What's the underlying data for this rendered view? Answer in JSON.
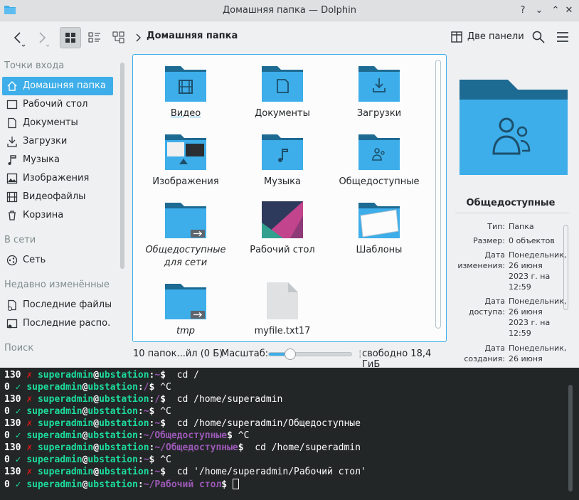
{
  "window": {
    "title": "Домашняя папка — Dolphin",
    "buttons": [
      "?",
      "⌄",
      "⌃",
      "✕"
    ]
  },
  "toolbar": {
    "breadcrumb": "Домашняя папка",
    "two_panels_label": "Две панели"
  },
  "sidebar": {
    "sections": {
      "places": "Точки входа",
      "network": "В сети",
      "recent": "Недавно изменённые",
      "search": "Поиск"
    },
    "places": [
      {
        "label": "Домашняя папка",
        "icon": "home-icon",
        "selected": true
      },
      {
        "label": "Рабочий стол",
        "icon": "desktop-icon"
      },
      {
        "label": "Документы",
        "icon": "documents-icon"
      },
      {
        "label": "Загрузки",
        "icon": "downloads-icon"
      },
      {
        "label": "Музыка",
        "icon": "music-icon"
      },
      {
        "label": "Изображения",
        "icon": "pictures-icon"
      },
      {
        "label": "Видеофайлы",
        "icon": "videos-icon"
      },
      {
        "label": "Корзина",
        "icon": "trash-icon"
      }
    ],
    "network": [
      {
        "label": "Сеть",
        "icon": "network-icon"
      }
    ],
    "recent": [
      {
        "label": "Последние файлы",
        "icon": "recent-files-icon"
      },
      {
        "label": "Последние распо...",
        "icon": "recent-locations-icon"
      }
    ]
  },
  "files": [
    {
      "name": "Видео",
      "kind": "videos-folder"
    },
    {
      "name": "Документы",
      "kind": "documents-folder"
    },
    {
      "name": "Загрузки",
      "kind": "downloads-folder"
    },
    {
      "name": "Изображения",
      "kind": "pictures-folder"
    },
    {
      "name": "Музыка",
      "kind": "music-folder"
    },
    {
      "name": "Общедоступные",
      "kind": "public-folder"
    },
    {
      "name": "Общедоступные для сети",
      "kind": "link-folder",
      "italic": true
    },
    {
      "name": "Рабочий стол",
      "kind": "desktop-thumbnail"
    },
    {
      "name": "Шаблоны",
      "kind": "templates-folder"
    },
    {
      "name": "tmp",
      "kind": "link-folder",
      "italic": true
    },
    {
      "name": "myfile.txt17",
      "kind": "text-file"
    }
  ],
  "status": {
    "summary": "10 папок...йл (0 Б)",
    "zoom_label": "Масштаб:",
    "zoom_value": 0.25,
    "free_space": "свободно 18,4 ГиБ"
  },
  "info_panel": {
    "name": "Общедоступные",
    "meta": [
      {
        "key": "Тип:",
        "value": "Папка"
      },
      {
        "key": "Размер:",
        "value": "0 объектов"
      },
      {
        "key": "Дата изменения:",
        "value": "Понедельник, 26 июня 2023 г. на 12:59"
      },
      {
        "key": "Дата доступа:",
        "value": "Понедельник, 26 июня 2023 г. на 12:59"
      },
      {
        "key": "Дата создания:",
        "value": "Понедельник, 26 июня"
      }
    ]
  },
  "terminal": {
    "lines": [
      {
        "code": "130",
        "ok": false,
        "user": "superadmin",
        "host": "ubstation",
        "path": "~",
        "cmd": " cd /"
      },
      {
        "code": "0",
        "ok": true,
        "user": "superadmin",
        "host": "ubstation",
        "path": "/",
        "cmd": "^C"
      },
      {
        "code": "130",
        "ok": false,
        "user": "superadmin",
        "host": "ubstation",
        "path": "/",
        "cmd": " cd /home/superadmin"
      },
      {
        "code": "0",
        "ok": true,
        "user": "superadmin",
        "host": "ubstation",
        "path": "~",
        "cmd": "^C"
      },
      {
        "code": "130",
        "ok": false,
        "user": "superadmin",
        "host": "ubstation",
        "path": "~",
        "cmd": " cd /home/superadmin/Общедоступные"
      },
      {
        "code": "0",
        "ok": true,
        "user": "superadmin",
        "host": "ubstation",
        "path": "~/Общедоступные",
        "cmd": "^C"
      },
      {
        "code": "130",
        "ok": false,
        "user": "superadmin",
        "host": "ubstation",
        "path": "~/Общедоступные",
        "cmd": " cd /home/superadmin"
      },
      {
        "code": "0",
        "ok": true,
        "user": "superadmin",
        "host": "ubstation",
        "path": "~",
        "cmd": "^C"
      },
      {
        "code": "130",
        "ok": false,
        "user": "superadmin",
        "host": "ubstation",
        "path": "~",
        "cmd": " cd '/home/superadmin/Рабочий стол'"
      },
      {
        "code": "0",
        "ok": true,
        "user": "superadmin",
        "host": "ubstation",
        "path": "~/Рабочий стол",
        "cmd": ""
      }
    ]
  },
  "colors": {
    "accent": "#3daee9",
    "folder": "#3daee9",
    "folder_dark": "#1d6a93",
    "terminal_bg": "#232627",
    "prompt_green": "#1cdc9a",
    "prompt_red": "#ed1515",
    "path_purple": "#9b59b6"
  }
}
